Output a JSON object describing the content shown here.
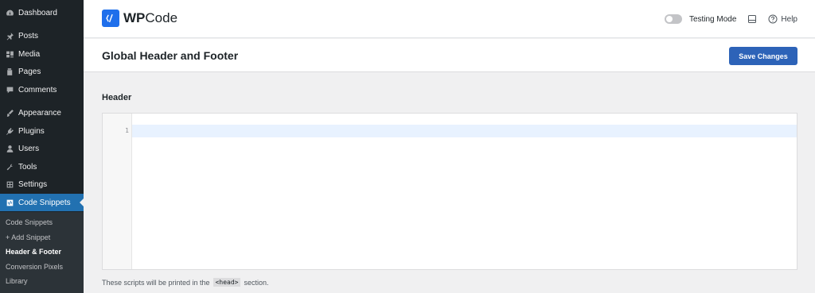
{
  "sidebar": {
    "items": [
      {
        "label": "Dashboard",
        "icon": "dashboard-icon"
      },
      {
        "label": "Posts",
        "icon": "pin-icon"
      },
      {
        "label": "Media",
        "icon": "media-icon"
      },
      {
        "label": "Pages",
        "icon": "pages-icon"
      },
      {
        "label": "Comments",
        "icon": "comments-icon"
      },
      {
        "label": "Appearance",
        "icon": "brush-icon"
      },
      {
        "label": "Plugins",
        "icon": "plugin-icon"
      },
      {
        "label": "Users",
        "icon": "users-icon"
      },
      {
        "label": "Tools",
        "icon": "wrench-icon"
      },
      {
        "label": "Settings",
        "icon": "settings-icon"
      },
      {
        "label": "Code Snippets",
        "icon": "code-snippets-icon",
        "active": true
      }
    ],
    "submenu": [
      {
        "label": "Code Snippets"
      },
      {
        "label": "+ Add Snippet"
      },
      {
        "label": "Header & Footer",
        "current": true
      },
      {
        "label": "Conversion Pixels"
      },
      {
        "label": "Library"
      }
    ]
  },
  "topbar": {
    "logo_bold": "WP",
    "logo_rest": "Code",
    "testing_mode_label": "Testing Mode",
    "testing_mode_on": false,
    "help_label": "Help"
  },
  "titlebar": {
    "title": "Global Header and Footer",
    "save_label": "Save Changes"
  },
  "content": {
    "section_label": "Header",
    "line_number": "1",
    "note_before": "These scripts will be printed in the",
    "note_code": "<head>",
    "note_after": "section."
  },
  "colors": {
    "sidebar_bg": "#1d2327",
    "accent": "#2271b1",
    "save_button": "#2d63b8",
    "logo": "#1f6feb"
  }
}
